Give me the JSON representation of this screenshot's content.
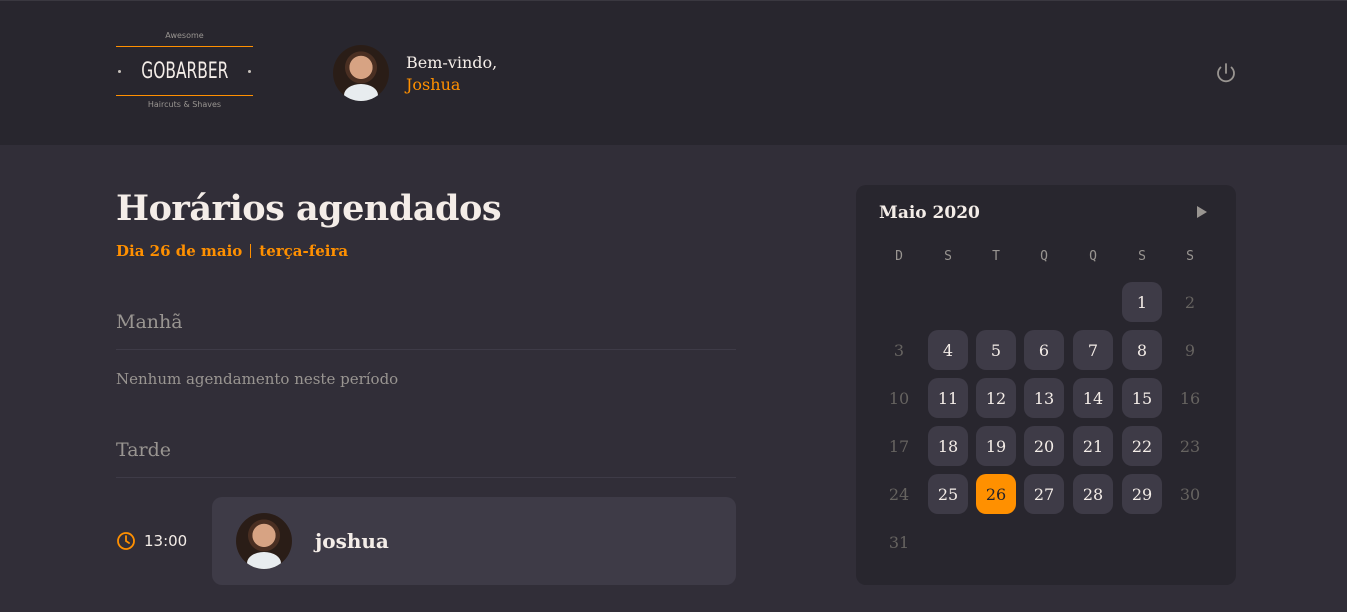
{
  "header": {
    "logo": {
      "top": "Awesome",
      "brand": "GOBARBER",
      "bottom": "Haircuts & Shaves"
    },
    "welcome_label": "Bem-vindo,",
    "user_name": "Joshua",
    "power_icon": "power-icon"
  },
  "schedule": {
    "title": "Horários agendados",
    "day": "Dia 26 de maio",
    "weekday": "terça-feira",
    "morning": {
      "title": "Manhã",
      "empty": "Nenhum agendamento neste período"
    },
    "afternoon": {
      "title": "Tarde",
      "appointments": [
        {
          "time": "13:00",
          "client": "joshua"
        }
      ]
    }
  },
  "calendar": {
    "month": "Maio 2020",
    "weekdays": [
      "D",
      "S",
      "T",
      "Q",
      "Q",
      "S",
      "S"
    ],
    "first_weekday": 5,
    "days": [
      "1",
      "2",
      "3",
      "4",
      "5",
      "6",
      "7",
      "8",
      "9",
      "10",
      "11",
      "12",
      "13",
      "14",
      "15",
      "16",
      "17",
      "18",
      "19",
      "20",
      "21",
      "22",
      "23",
      "24",
      "25",
      "26",
      "27",
      "28",
      "29",
      "30",
      "31"
    ],
    "selected_day": 26,
    "disabled_days": [
      2,
      3,
      9,
      10,
      16,
      17,
      23,
      24,
      30,
      31
    ]
  },
  "colors": {
    "accent": "#ff9000",
    "background": "#312e38",
    "panel": "#28262e",
    "card": "#3e3b47"
  }
}
